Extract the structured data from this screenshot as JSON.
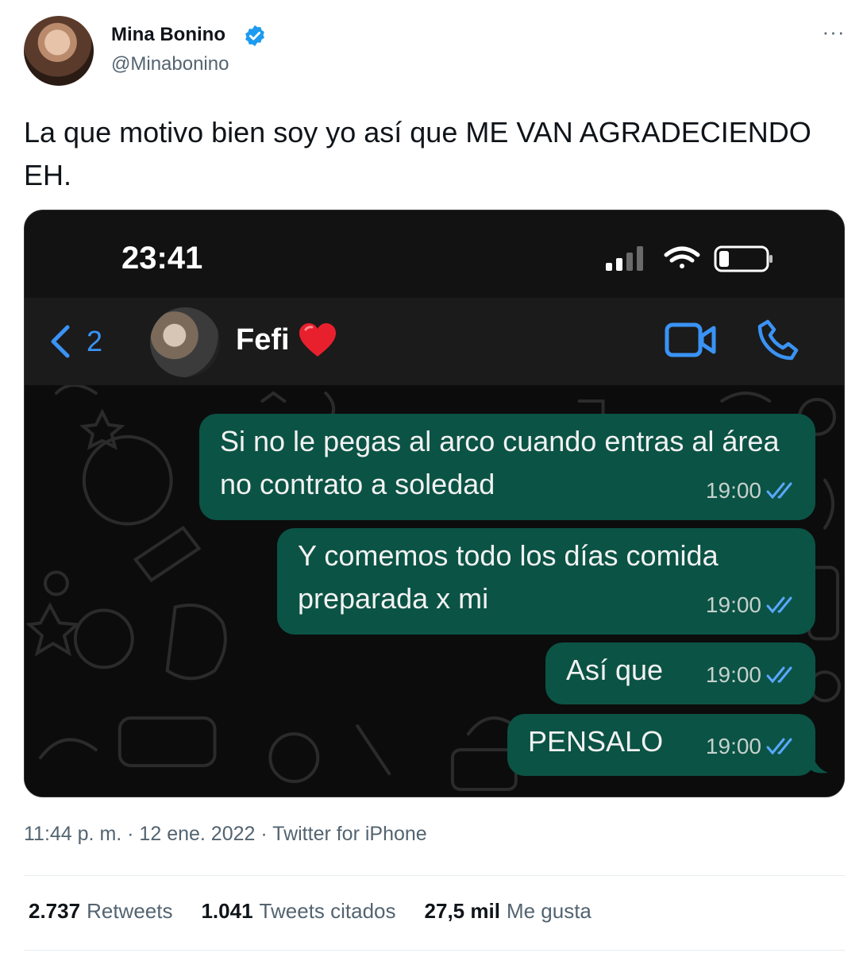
{
  "author": {
    "name": "Mina Bonino",
    "handle": "@Minabonino",
    "verified_color": "#1d9bf0"
  },
  "more_icon": "more-horizontal-icon",
  "more_label": "···",
  "tweet": {
    "text": "La que motivo bien soy yo así que ME VAN AGRADECIENDO EH."
  },
  "screenshot": {
    "status_time": "23:41",
    "back_count": "2",
    "contact_name": "Fefi",
    "messages": [
      {
        "text": "Si no le pegas al arco cuando entras al área no contrato a soledad",
        "time": "19:00"
      },
      {
        "text": "Y comemos todo los días comida preparada x mi",
        "time": "19:00"
      },
      {
        "text": "Así que",
        "time": "19:00"
      },
      {
        "text": "PENSALO",
        "time": "19:00"
      }
    ],
    "accent": "#3a93f5",
    "bubble_color": "#0b5345"
  },
  "footer": {
    "meta": "11:44 p. m. · 12 ene. 2022 · Twitter for iPhone"
  },
  "stats": [
    {
      "value": "2.737",
      "label": "Retweets"
    },
    {
      "value": "1.041",
      "label": "Tweets citados"
    },
    {
      "value": "27,5 mil",
      "label": "Me gusta"
    }
  ]
}
